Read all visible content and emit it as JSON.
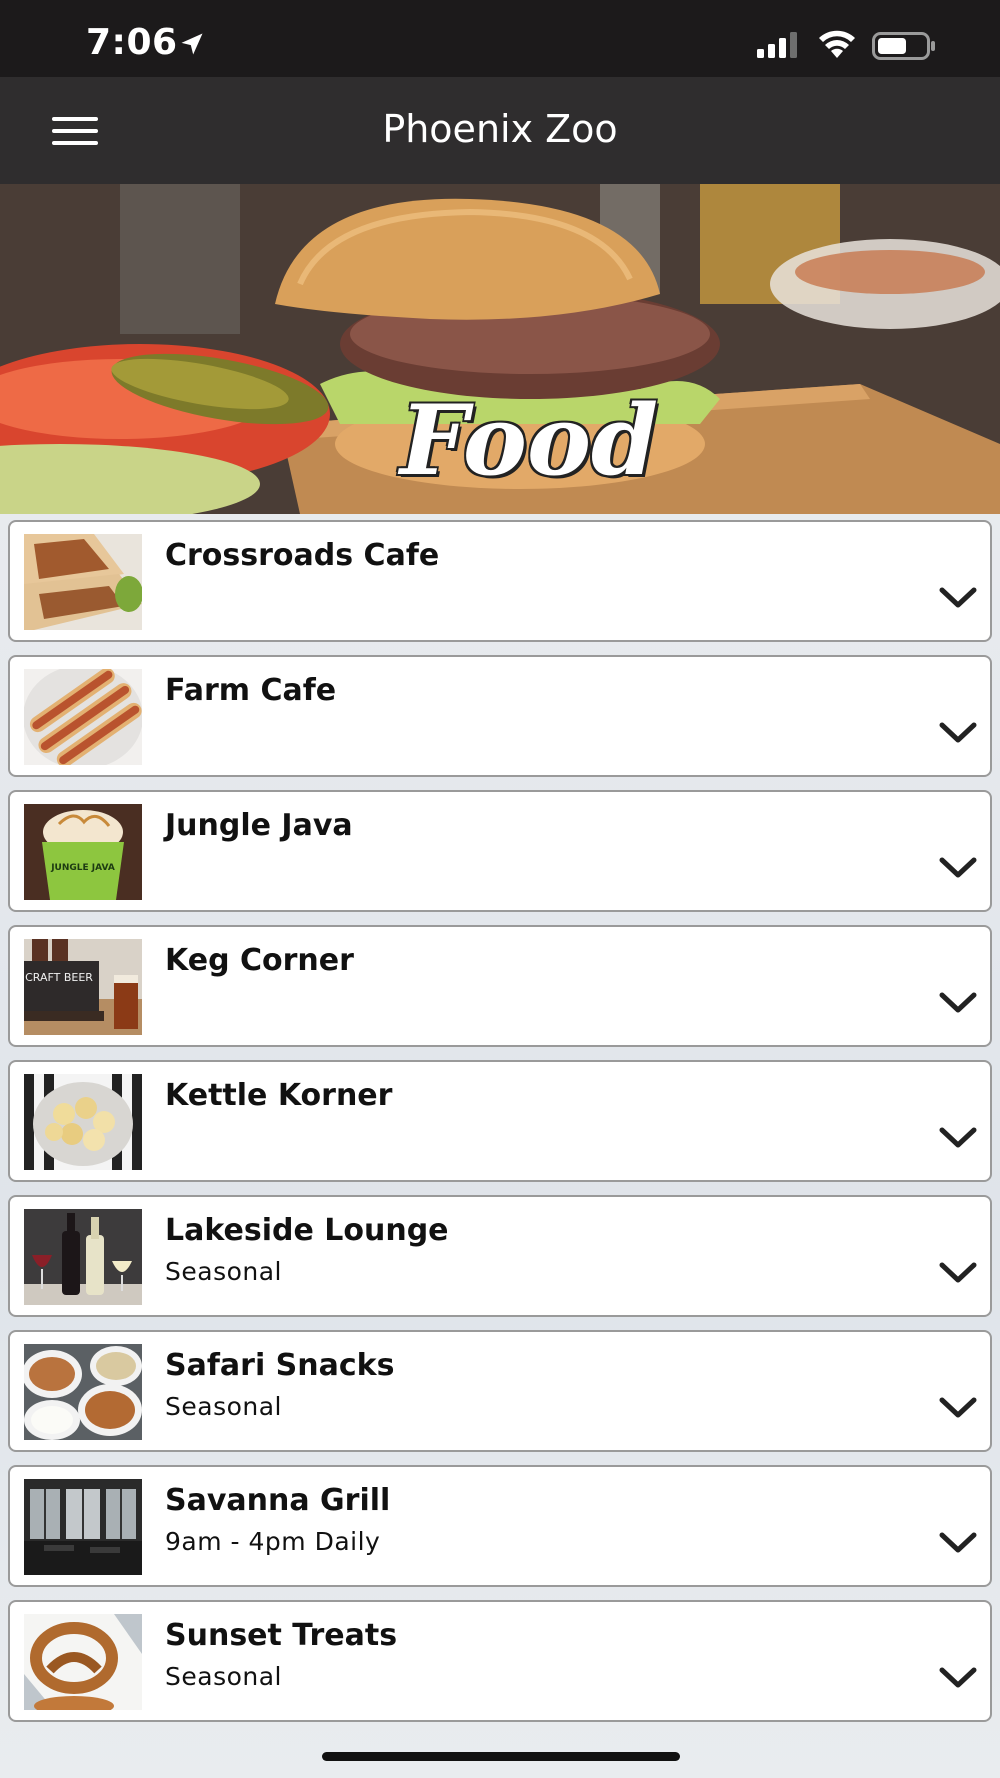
{
  "status_bar": {
    "time": "7:06",
    "icons": [
      "location-arrow-icon",
      "cellular-signal-icon",
      "wifi-icon",
      "battery-icon"
    ]
  },
  "nav": {
    "title": "Phoenix Zoo",
    "menu_icon": "hamburger-menu-icon"
  },
  "hero": {
    "title": "Food"
  },
  "venues": [
    {
      "name": "Crossroads Cafe",
      "subtitle": "",
      "thumb": "burrito"
    },
    {
      "name": "Farm Cafe",
      "subtitle": "",
      "thumb": "hot-dogs"
    },
    {
      "name": "Jungle Java",
      "subtitle": "",
      "thumb": "coffee-cup"
    },
    {
      "name": "Keg Corner",
      "subtitle": "",
      "thumb": "craft-beer"
    },
    {
      "name": "Kettle Korner",
      "subtitle": "",
      "thumb": "kettle-corn"
    },
    {
      "name": "Lakeside Lounge",
      "subtitle": "Seasonal",
      "thumb": "wine-bottles"
    },
    {
      "name": "Safari Snacks",
      "subtitle": "Seasonal",
      "thumb": "snack-bowls"
    },
    {
      "name": "Savanna Grill",
      "subtitle": "9am - 4pm Daily",
      "thumb": "restaurant-interior"
    },
    {
      "name": "Sunset Treats",
      "subtitle": "Seasonal",
      "thumb": "pretzel"
    }
  ],
  "thumb_labels": {
    "coffee_cup": "JUNGLE JAVA",
    "craft_beer": "CRAFT BEER"
  },
  "colors": {
    "status_bar_bg": "#1c1a1b",
    "nav_bg": "#2f2d2e",
    "card_border": "#9a9a9a"
  }
}
